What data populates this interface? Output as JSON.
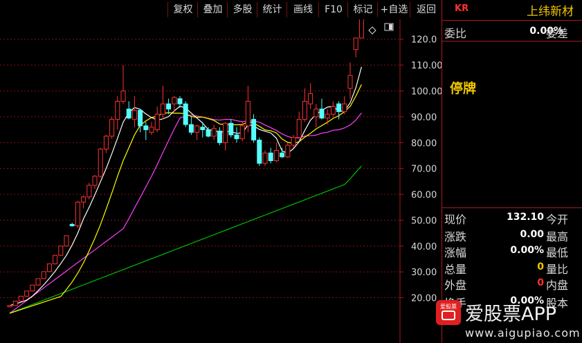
{
  "toolbar": {
    "buttons": [
      "复权",
      "叠加",
      "多股",
      "统计",
      "画线",
      "F10",
      "标记",
      "+自选",
      "返回"
    ]
  },
  "stock": {
    "market_badge": "KR",
    "name": "上纬新材"
  },
  "panel": {
    "weibi_label": "委比",
    "weibi_value": "0.00%",
    "weicha_label": "委差",
    "halt_text": "停牌",
    "rows": [
      {
        "label": "现价",
        "value": "132.10",
        "label2": "今开",
        "value_color": "#ffffff"
      },
      {
        "label": "涨跌",
        "value": "0.00",
        "label2": "最高",
        "value_color": "#ffffff"
      },
      {
        "label": "涨幅",
        "value": "0.00%",
        "label2": "最低",
        "value_color": "#ffffff"
      },
      {
        "label": "总量",
        "value": "0",
        "label2": "量比",
        "value_color": "#f0c800"
      },
      {
        "label": "外盘",
        "value": "0",
        "label2": "内盘",
        "value_color": "#ff3030"
      },
      {
        "label": "换手",
        "value": "0.00%",
        "label2": "股本",
        "value_color": "#ffffff"
      }
    ]
  },
  "watermark": {
    "logo_text": "爱股票",
    "brand": "爱股票APP",
    "url": "www.aigupiao.com"
  },
  "chart_data": {
    "type": "candlestick",
    "ylim": [
      15,
      140
    ],
    "yticks": [
      20,
      30,
      40,
      50,
      60,
      70,
      80,
      90,
      100,
      110,
      120
    ],
    "ytick_labels": [
      "20.00",
      "30.00",
      "40.00",
      "50.00",
      "60.00",
      "70.00",
      "80.00",
      "90.00",
      "100.00",
      "110.00",
      "120.0"
    ],
    "latest_price_label": "132.10",
    "latest_price": 132.1,
    "colors": {
      "up": "#ff3232",
      "down": "#54ffff",
      "ma5": "#ffffff",
      "ma10": "#ffff00",
      "ma20": "#ff40ff",
      "ma60": "#00c000",
      "grid": "#8a1010",
      "axis": "#b01818",
      "text": "#d8d8d8"
    },
    "candles": [
      [
        16.5,
        17.2,
        16.3,
        17.0
      ],
      [
        17.0,
        18.8,
        16.9,
        18.7
      ],
      [
        18.7,
        20.6,
        18.5,
        20.6
      ],
      [
        20.6,
        22.6,
        20.4,
        22.6
      ],
      [
        22.6,
        24.9,
        22.4,
        24.9
      ],
      [
        24.9,
        27.4,
        24.7,
        27.4
      ],
      [
        27.4,
        30.1,
        27.2,
        30.1
      ],
      [
        30.1,
        33.1,
        29.9,
        33.1
      ],
      [
        33.1,
        36.4,
        32.9,
        36.4
      ],
      [
        36.4,
        40.0,
        36.2,
        40.0
      ],
      [
        40.0,
        44.0,
        39.8,
        44.0
      ],
      [
        48.4,
        49.0,
        47.5,
        47.8
      ],
      [
        47.8,
        57.5,
        47.0,
        57.0
      ],
      [
        57.0,
        59.5,
        54.5,
        59.0
      ],
      [
        59.0,
        64.5,
        58.0,
        63.5
      ],
      [
        63.5,
        67.5,
        62.0,
        67.0
      ],
      [
        67.0,
        78.0,
        66.5,
        77.5
      ],
      [
        77.5,
        83.0,
        76.0,
        82.5
      ],
      [
        82.5,
        90.0,
        81.5,
        89.0
      ],
      [
        89.0,
        98.0,
        85.0,
        96.0
      ],
      [
        96.0,
        110.0,
        95.0,
        100.0
      ],
      [
        93.0,
        96.0,
        89.0,
        89.5
      ],
      [
        89.0,
        98.0,
        86.0,
        92.5
      ],
      [
        92.5,
        93.0,
        84.0,
        86.5
      ],
      [
        86.5,
        88.0,
        81.0,
        85.0
      ],
      [
        84.0,
        88.0,
        83.0,
        86.0
      ],
      [
        85.0,
        94.0,
        84.0,
        91.0
      ],
      [
        91.0,
        102.0,
        89.0,
        95.0
      ],
      [
        95.0,
        97.0,
        91.0,
        93.0
      ],
      [
        95.0,
        98.0,
        92.0,
        97.5
      ],
      [
        97.0,
        98.0,
        93.5,
        95.0
      ],
      [
        95.0,
        96.0,
        86.0,
        87.0
      ],
      [
        87.0,
        90.0,
        83.0,
        84.0
      ],
      [
        84.0,
        87.0,
        81.0,
        86.5
      ],
      [
        86.0,
        88.0,
        82.0,
        85.0
      ],
      [
        85.0,
        86.0,
        82.0,
        82.5
      ],
      [
        82.5,
        87.0,
        81.0,
        85.5
      ],
      [
        84.5,
        86.0,
        79.0,
        80.0
      ],
      [
        80.0,
        88.0,
        77.0,
        87.5
      ],
      [
        87.5,
        89.0,
        82.0,
        83.0
      ],
      [
        83.0,
        86.0,
        80.0,
        81.5
      ],
      [
        81.5,
        88.0,
        80.5,
        86.5
      ],
      [
        86.5,
        102.0,
        84.0,
        96.0
      ],
      [
        89.0,
        91.0,
        80.0,
        81.0
      ],
      [
        81.0,
        82.0,
        71.0,
        72.0
      ],
      [
        72.0,
        77.0,
        71.0,
        76.0
      ],
      [
        76.0,
        78.0,
        72.0,
        73.0
      ],
      [
        73.0,
        80.0,
        72.5,
        77.0
      ],
      [
        76.0,
        78.0,
        74.0,
        74.5
      ],
      [
        74.5,
        80.0,
        74.0,
        79.0
      ],
      [
        79.0,
        83.0,
        78.0,
        82.0
      ],
      [
        82.0,
        92.0,
        81.0,
        89.0
      ],
      [
        89.0,
        101.0,
        88.0,
        96.0
      ],
      [
        95.0,
        103.0,
        93.0,
        99.0
      ],
      [
        90.0,
        95.0,
        86.0,
        93.0
      ],
      [
        93.0,
        97.0,
        89.0,
        89.5
      ],
      [
        89.5,
        93.0,
        87.0,
        91.0
      ],
      [
        91.0,
        96.0,
        90.0,
        94.0
      ],
      [
        95.0,
        96.0,
        89.0,
        92.0
      ],
      [
        92.0,
        98.0,
        91.0,
        95.0
      ],
      [
        101.0,
        111.0,
        97.0,
        106.0
      ],
      [
        116.0,
        120.5,
        113.0,
        120.5
      ],
      [
        120.5,
        132.1,
        120.5,
        132.1
      ]
    ],
    "ma5": [
      17,
      17.6,
      18.3,
      19.1,
      20.6,
      22.7,
      25,
      27.5,
      30.2,
      33.2,
      36.4,
      40.4,
      45,
      50.5,
      55,
      59.8,
      64.9,
      70,
      75.7,
      81.7,
      87.9,
      91.6,
      93.6,
      92.9,
      91.1,
      89.7,
      88.7,
      89.2,
      90.1,
      92.3,
      94.1,
      93.4,
      91.4,
      89.5,
      87.6,
      85,
      84.7,
      84,
      84.3,
      84.3,
      83.6,
      83.8,
      86.9,
      86.5,
      85.1,
      84.4,
      83.8,
      81.7,
      76.8,
      75.9,
      77.7,
      80.3,
      84.7,
      88.7,
      90.9,
      92.5,
      93.7,
      94.1,
      92.1,
      92.3,
      95.4,
      101.2,
      109.3
    ],
    "ma10": [
      null,
      null,
      null,
      null,
      null,
      null,
      null,
      null,
      null,
      20.5,
      23.2,
      26.1,
      29.5,
      33.5,
      38.1,
      43,
      48.3,
      54.3,
      60.5,
      67,
      73,
      78,
      83,
      86.7,
      88.4,
      89.7,
      90.2,
      91.3,
      91.6,
      91.4,
      91.4,
      91.2,
      90.1,
      89.8,
      89.9,
      89.3,
      88.6,
      87.2,
      87,
      87,
      86.9,
      87,
      88.1,
      87.5,
      86.3,
      84.9,
      84.6,
      83.8,
      81.4,
      80.1,
      79.7,
      80.4,
      82.1,
      83.6,
      85.3,
      86.6,
      87.9,
      89.4,
      90.4,
      92,
      94,
      98,
      102.5
    ],
    "ma20": [
      null,
      null,
      null,
      null,
      null,
      null,
      null,
      null,
      null,
      null,
      null,
      null,
      null,
      null,
      null,
      null,
      null,
      null,
      null,
      null,
      46.7,
      50.6,
      54.7,
      58.8,
      62.9,
      67,
      71.5,
      76.2,
      80.8,
      85.3,
      89.5,
      90.3,
      90.7,
      90.3,
      89.9,
      89.4,
      88.9,
      88.7,
      89,
      89,
      88.5,
      88.1,
      88.4,
      88.4,
      87.9,
      86.8,
      85.8,
      84.7,
      83.4,
      82.4,
      81.8,
      81.9,
      82.5,
      82.7,
      82.9,
      83.7,
      84,
      84.8,
      85,
      85.7,
      86.8,
      88.7,
      91.5
    ],
    "ma60": [
      null,
      null,
      null,
      null,
      null,
      null,
      null,
      null,
      null,
      null,
      null,
      null,
      null,
      null,
      null,
      null,
      null,
      null,
      null,
      null,
      null,
      null,
      null,
      null,
      null,
      null,
      null,
      null,
      null,
      null,
      null,
      null,
      null,
      null,
      null,
      null,
      null,
      null,
      null,
      null,
      null,
      null,
      null,
      null,
      null,
      null,
      null,
      null,
      null,
      null,
      null,
      null,
      null,
      null,
      null,
      null,
      null,
      null,
      null,
      63.8,
      66,
      68.5,
      71
    ]
  }
}
